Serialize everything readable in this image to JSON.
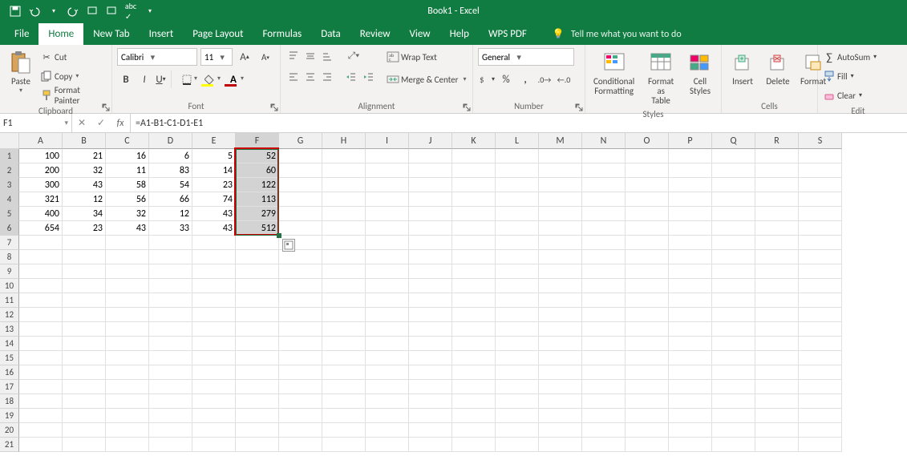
{
  "app_title": "Book1 - Excel",
  "tabs": [
    "File",
    "Home",
    "New Tab",
    "Insert",
    "Page Layout",
    "Formulas",
    "Data",
    "Review",
    "View",
    "Help",
    "WPS PDF"
  ],
  "active_tab": 1,
  "tellme": "Tell me what you want to do",
  "clipboard": {
    "paste": "Paste",
    "cut": "Cut",
    "copy": "Copy",
    "painter": "Format Painter",
    "label": "Clipboard"
  },
  "font": {
    "name": "Calibri",
    "size": "11",
    "label": "Font"
  },
  "alignment": {
    "wrap": "Wrap Text",
    "merge": "Merge & Center",
    "label": "Alignment"
  },
  "number": {
    "format": "General",
    "label": "Number"
  },
  "styles": {
    "cond": "Conditional\nFormatting",
    "table": "Format as\nTable",
    "cell": "Cell\nStyles",
    "label": "Styles"
  },
  "cells_group": {
    "insert": "Insert",
    "delete": "Delete",
    "format": "Format",
    "label": "Cells"
  },
  "editing": {
    "autosum": "AutoSum",
    "fill": "Fill",
    "clear": "Clear",
    "label": "Edit"
  },
  "name_box": "F1",
  "formula": "=A1-B1-C1-D1-E1",
  "columns": [
    "A",
    "B",
    "C",
    "D",
    "E",
    "F",
    "G",
    "H",
    "I",
    "J",
    "K",
    "L",
    "M",
    "N",
    "O",
    "P",
    "Q",
    "R",
    "S"
  ],
  "row_count": 21,
  "selected_col": 5,
  "selected_rows": [
    0,
    1,
    2,
    3,
    4,
    5
  ],
  "data": [
    [
      100,
      21,
      16,
      6,
      5,
      52
    ],
    [
      200,
      32,
      11,
      83,
      14,
      60
    ],
    [
      300,
      43,
      58,
      54,
      23,
      122
    ],
    [
      321,
      12,
      56,
      66,
      74,
      113
    ],
    [
      400,
      34,
      32,
      12,
      43,
      279
    ],
    [
      654,
      23,
      43,
      33,
      43,
      512
    ]
  ],
  "chart_data": {
    "type": "table",
    "columns": [
      "A",
      "B",
      "C",
      "D",
      "E",
      "F"
    ],
    "rows": [
      [
        100,
        21,
        16,
        6,
        5,
        52
      ],
      [
        200,
        32,
        11,
        83,
        14,
        60
      ],
      [
        300,
        43,
        58,
        54,
        23,
        122
      ],
      [
        321,
        12,
        56,
        66,
        74,
        113
      ],
      [
        400,
        34,
        32,
        12,
        43,
        279
      ],
      [
        654,
        23,
        43,
        33,
        43,
        512
      ]
    ],
    "formula_F": "=A-B-C-D-E"
  }
}
